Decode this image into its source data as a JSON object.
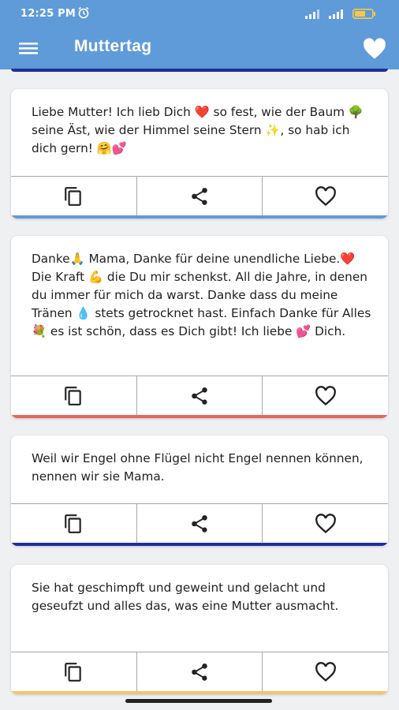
{
  "status": {
    "time": "12:25 PM"
  },
  "appbar": {
    "title": "Muttertag"
  },
  "cards": [
    {
      "text": "Liebe Mutter! Ich lieb Dich ❤️ so fest, wie der Baum 🌳 seine Äst,  wie der Himmel seine Stern ✨, so hab ich dich gern! 🤗💕",
      "bar_color": "#5f9bd8"
    },
    {
      "text": "Danke🙏 Mama, Danke für deine unendliche Liebe.❤️ Die Kraft 💪 die Du mir schenkst. All die Jahre, in denen du immer für mich da warst. Danke dass du meine Tränen 💧 stets getrocknet hast. Einfach Danke für Alles 💐 es ist schön, dass es Dich gibt! Ich liebe 💕 Dich.",
      "bar_color": "#e06a5e"
    },
    {
      "text": "Weil wir Engel ohne Flügel nicht Engel nennen können, nennen wir sie Mama.",
      "bar_color": "#1f2f9c"
    },
    {
      "text": "Sie hat geschimpft und geweint und gelacht und geseufzt und alles das, was eine Mutter ausmacht.",
      "bar_color": "#f2c66d"
    }
  ]
}
